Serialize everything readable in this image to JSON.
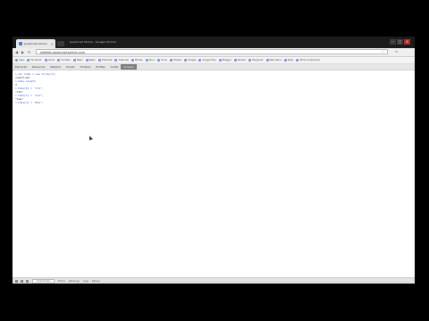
{
  "window": {
    "tab_title": "JavaScript Online",
    "title": "JavaScript Online - Google Chrome",
    "url": "jsfiddle.javascriptonline.com"
  },
  "bookmarks": [
    "Apps",
    "Facebook",
    "Gmail",
    "YouTube",
    "Maps",
    "News",
    "Translate",
    "Calendar",
    "Photos",
    "Docs",
    "Drive",
    "Sheets",
    "Images",
    "Google Play",
    "Blogger",
    "Reader",
    "Hangouts",
    "Web Store",
    "Keep",
    "Other bookmarks"
  ],
  "devtools": {
    "tabs": [
      "Elements",
      "Resources",
      "Network",
      "Scripts",
      "Timeline",
      "Profiles",
      "Audits",
      "Console"
    ],
    "active_tab": "Console"
  },
  "console_lines": [
    {
      "kind": "in",
      "text": "var Cube = new Array(3);"
    },
    {
      "kind": "out",
      "text": "undefined"
    },
    {
      "kind": "in",
      "text": "Cube.length"
    },
    {
      "kind": "out",
      "text": "3"
    },
    {
      "kind": "in",
      "text": "Cube[0] = \"Jim\";"
    },
    {
      "kind": "out",
      "text": "\"Jim\""
    },
    {
      "kind": "in",
      "text": "Cube[1] = \"Joe\";"
    },
    {
      "kind": "out",
      "text": "\"Joe\""
    },
    {
      "kind": "in",
      "text": "Cube[2] = \"Bob\";"
    }
  ],
  "statusbar": {
    "items": [
      "Errors",
      "Warnings",
      "Logs",
      "Debug"
    ],
    "frame": "<top frame>"
  }
}
